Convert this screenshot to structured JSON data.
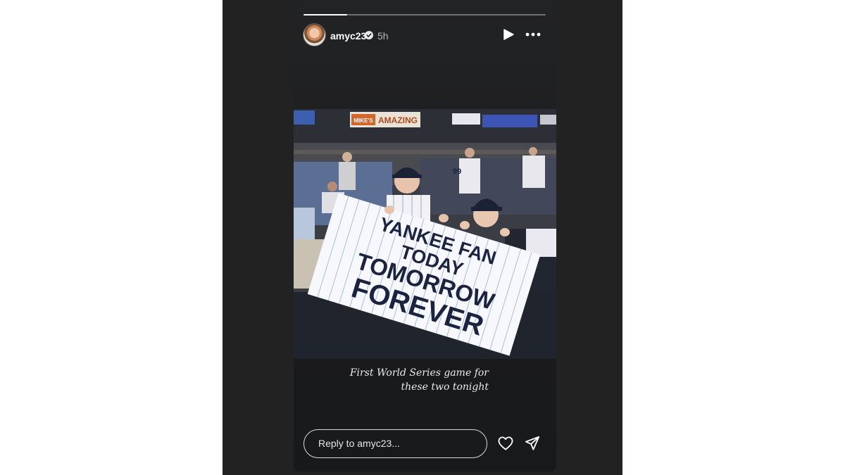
{
  "story": {
    "progress": 0.18,
    "author": {
      "username": "amyc23",
      "verified": true,
      "time_ago": "5h"
    },
    "photo": {
      "scoreboard_text": "AMAZING",
      "scoreboard_prefix": "MIKE'S",
      "sign_lines": [
        "YANKEE FAN",
        "TODAY",
        "TOMORROW",
        "FOREVER"
      ]
    },
    "caption_lines": [
      "First World Series game for",
      "these two tonight"
    ],
    "reply": {
      "placeholder": "Reply to amyc23..."
    }
  },
  "icons": {
    "verified": "verified-badge-icon",
    "play": "play-icon",
    "more": "more-options-icon",
    "like": "heart-icon",
    "share": "send-icon"
  },
  "colors": {
    "backdrop": "#222222",
    "story_bg": "#1e1f21",
    "sign_text": "#1b2340",
    "pinstripe": "#a9bde0"
  }
}
